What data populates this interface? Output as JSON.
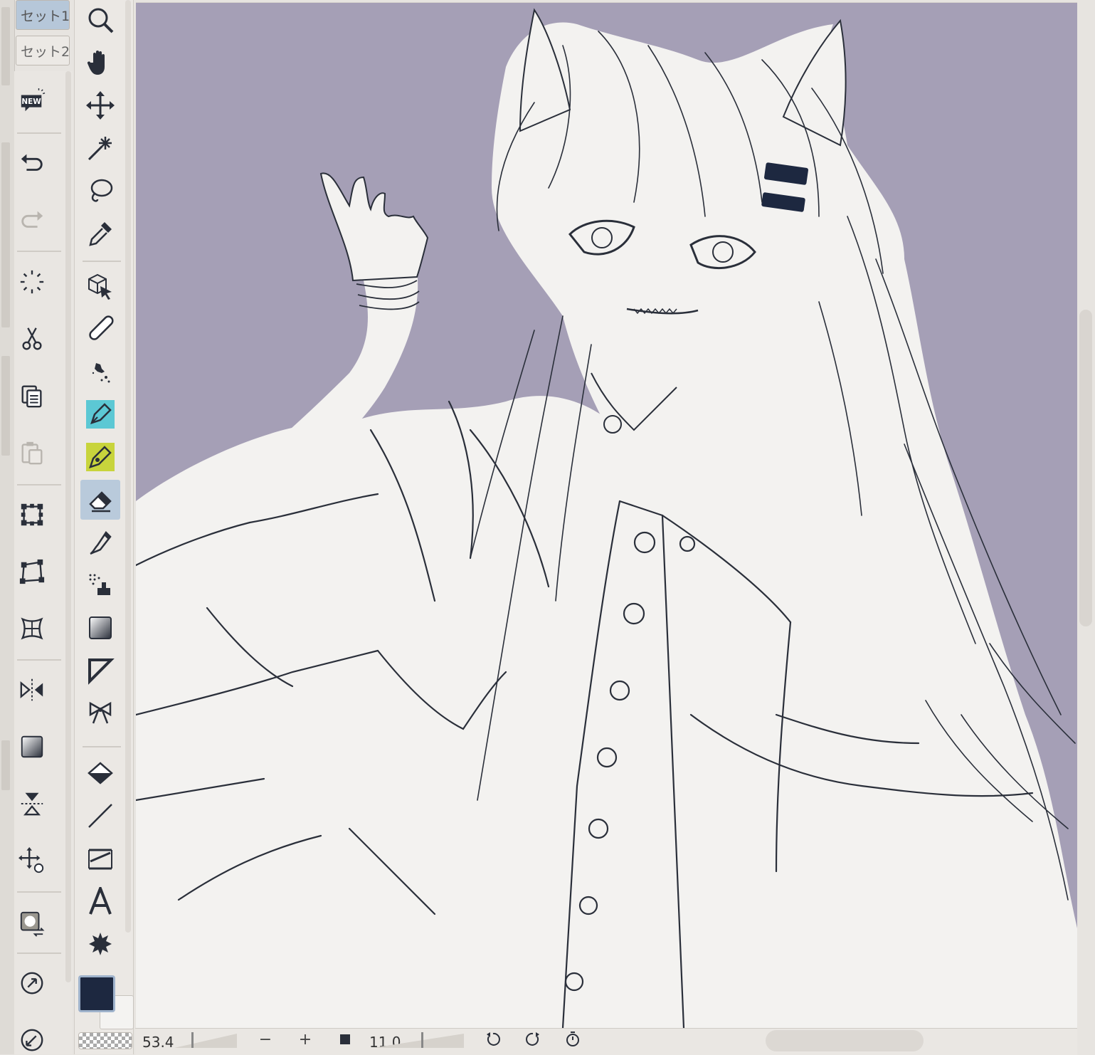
{
  "palette_tabs": [
    "セット1",
    "セット2"
  ],
  "commands": [
    {
      "name": "new-icon",
      "label": "NEW"
    },
    {
      "name": "undo-icon"
    },
    {
      "name": "redo-icon"
    },
    {
      "name": "busy-icon"
    },
    {
      "name": "cut-icon"
    },
    {
      "name": "copy-icon"
    },
    {
      "name": "paste-icon"
    },
    {
      "name": "transform-icon"
    },
    {
      "name": "free-transform-icon"
    },
    {
      "name": "mesh-transform-icon"
    },
    {
      "name": "flip-horizontal-icon"
    },
    {
      "name": "gradient-icon"
    },
    {
      "name": "flip-vertical-icon"
    },
    {
      "name": "move-layer-icon"
    },
    {
      "name": "convert-layer-icon"
    },
    {
      "name": "rotate-icon"
    },
    {
      "name": "reset-rotate-icon"
    }
  ],
  "tools": [
    "zoom-icon",
    "hand-icon",
    "move-icon",
    "auto-select-icon",
    "lasso-icon",
    "eyedropper-icon",
    "object-select-icon",
    "ruler-icon",
    "airbrush-splatter-icon",
    "pen-icon",
    "pencil-icon",
    "eraser-icon",
    "brush-icon",
    "airbrush-icon",
    "blend-icon",
    "figure-icon",
    "decoration-icon",
    "fill-icon",
    "line-icon",
    "frame-icon",
    "text-icon",
    "balloon-icon"
  ],
  "active_tool": "eraser-icon",
  "colors": {
    "foreground": "#1d2840",
    "background": "#f4f3f1",
    "canvas": "#a59fb6",
    "active_tool_bg": "#b9cadb"
  },
  "bottom": {
    "zoom": "53.4",
    "zoom_out": "−",
    "zoom_in": "+",
    "angle": "11.0"
  }
}
